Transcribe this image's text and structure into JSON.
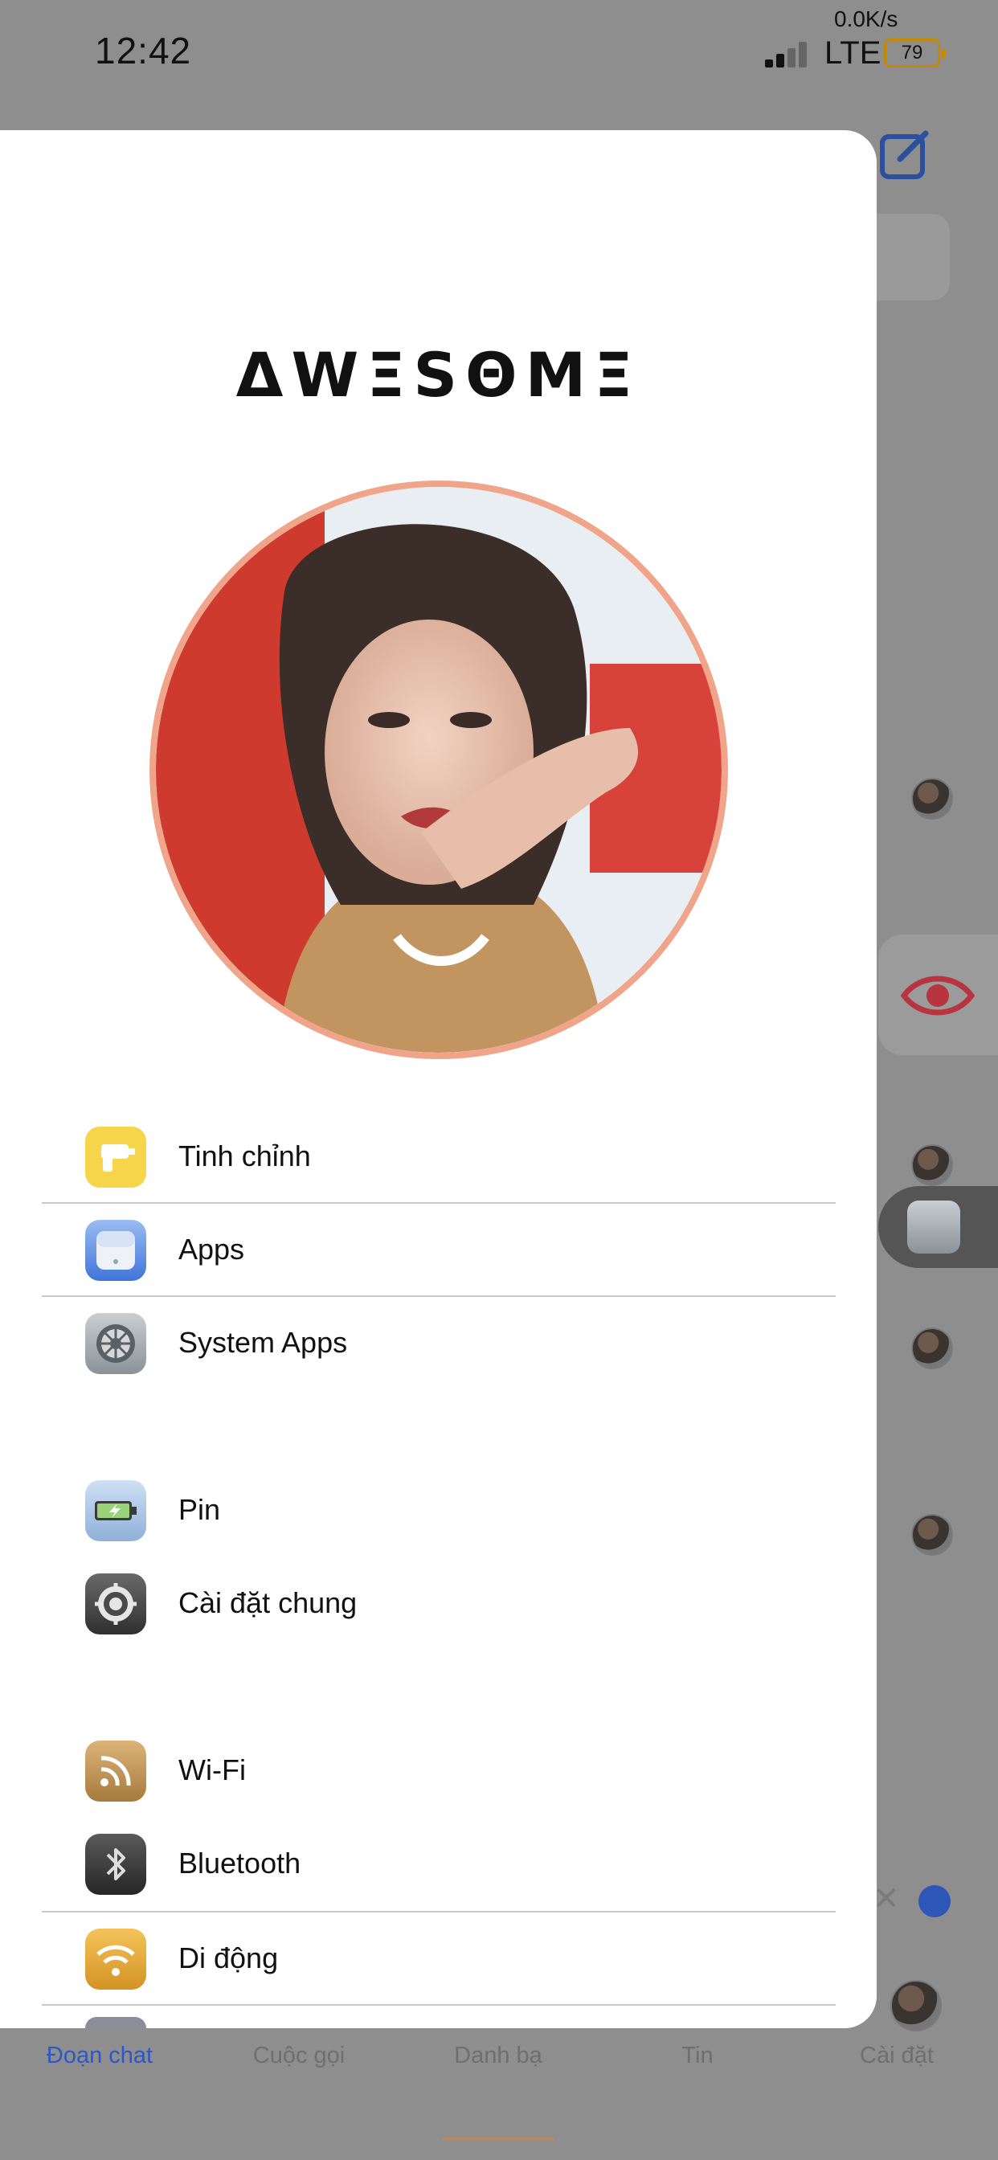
{
  "status_bar": {
    "time": "12:42",
    "net_speed": "0.0K/s",
    "network": "LTE",
    "battery": "79"
  },
  "drawer": {
    "brand": "ΔWΞSΘMΞ",
    "sections": [
      {
        "items": [
          {
            "label": "Tinh chỉnh",
            "icon": "drill-icon"
          },
          {
            "label": "Apps",
            "icon": "apps-icon"
          },
          {
            "label": "System Apps",
            "icon": "system-gear-icon"
          }
        ]
      },
      {
        "items": [
          {
            "label": "Pin",
            "icon": "battery-icon"
          },
          {
            "label": "Cài đặt chung",
            "icon": "settings-icon"
          }
        ]
      },
      {
        "items": [
          {
            "label": "Wi-Fi",
            "icon": "wifi-icon"
          },
          {
            "label": "Bluetooth",
            "icon": "bluetooth-icon"
          },
          {
            "label": "Di động",
            "icon": "cellular-icon"
          }
        ]
      }
    ]
  },
  "tab_bar": {
    "tabs": [
      "Đoạn chat",
      "Cuộc gọi",
      "Danh bạ",
      "Tin",
      "Cài đặt"
    ],
    "active": "Đoạn chat"
  },
  "colors": {
    "accent": "#2c57c8",
    "avatar_ring": "#f0a48a",
    "overlay": "#8e8e8e"
  }
}
